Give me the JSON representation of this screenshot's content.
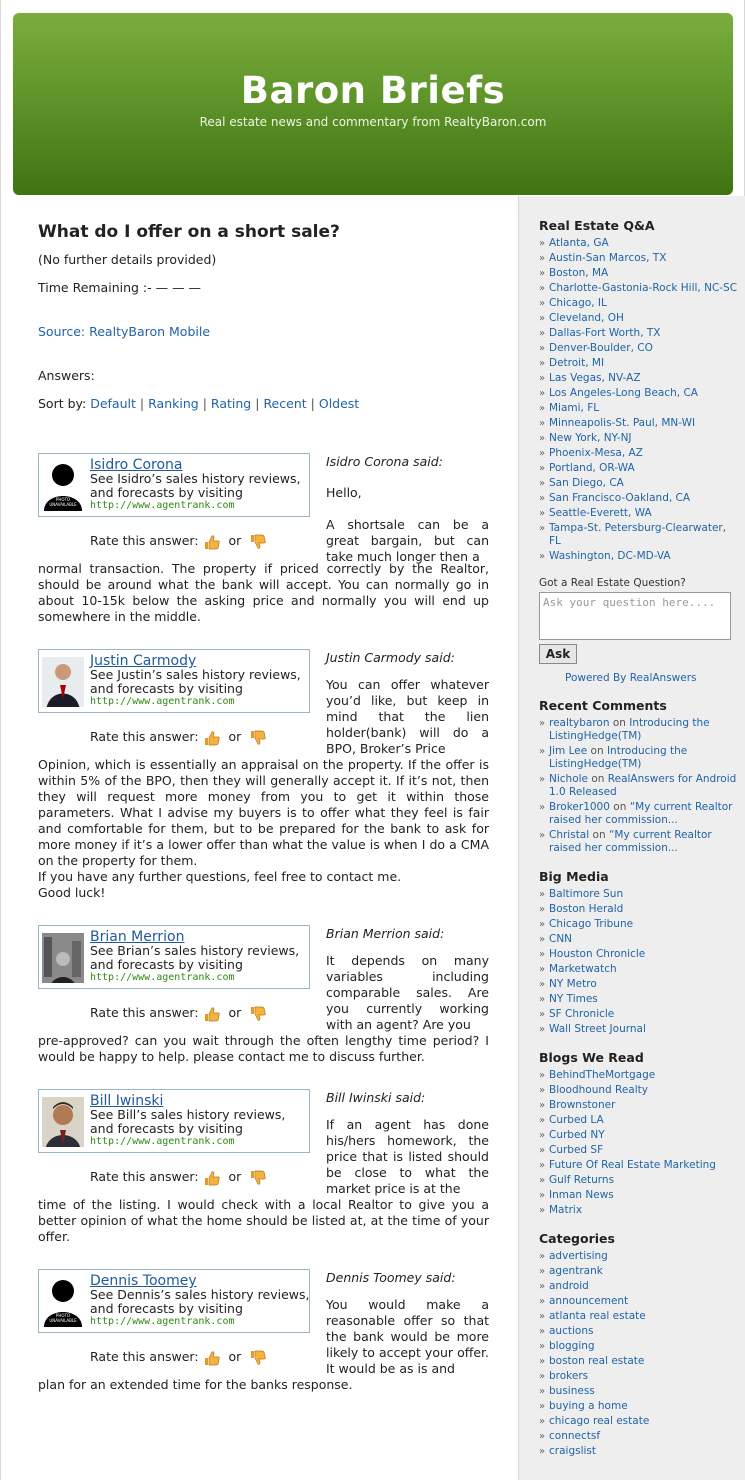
{
  "site": {
    "title": "Baron Briefs",
    "tagline": "Real estate news and commentary from RealtyBaron.com"
  },
  "post": {
    "title": "What do I offer on a short sale?",
    "details": "(No further details provided)",
    "time_remaining": "Time Remaining :- — — —",
    "source": "Source: RealtyBaron Mobile",
    "answers_label": "Answers:",
    "sort_label": "Sort by:",
    "sort_options": [
      "Default",
      "Ranking",
      "Rating",
      "Recent",
      "Oldest"
    ]
  },
  "rate_label": "Rate this answer:",
  "rate_or": "or",
  "answers": [
    {
      "name": "Isidro Corona",
      "desc": "See Isidro’s sales history reviews, and forecasts by visiting",
      "url": "http://www.agentrank.com",
      "said": "Isidro Corona said:",
      "hello": "Hello,",
      "text_side": "A shortsale can be a great bargain, but can take much longer then a",
      "text_full": "normal transaction. The property if priced correctly by the Realtor, should be around what the bank will accept. You can normally go in about 10-15k below the asking price and normally you will end up somewhere in the middle."
    },
    {
      "name": "Justin Carmody",
      "desc": "See Justin’s sales history reviews, and forecasts by visiting",
      "url": "http://www.agentrank.com",
      "said": "Justin Carmody said:",
      "text_side": "You can offer whatever you’d like, but keep in mind that the lien holder(bank) will do a BPO, Broker’s Price",
      "text_full": "Opinion, which is essentially an appraisal on the property. If the offer is within 5% of the BPO, then they will generally accept it. If it’s not, then they will request more money from you to get it within those parameters. What I advise my buyers is to offer what they feel is fair and comfortable for them, but to be prepared for the bank to ask for more money if it’s a lower offer than what the value is when I do a CMA on the property for them.",
      "text_extra1": "If you have any further questions, feel free to contact me.",
      "text_extra2": "Good luck!"
    },
    {
      "name": "Brian Merrion",
      "desc": "See Brian’s sales history reviews, and forecasts by visiting",
      "url": "http://www.agentrank.com",
      "said": "Brian Merrion said:",
      "text_side": "It depends on many variables including comparable sales. Are you currently working with an agent? Are you",
      "text_full": "pre-approved? can you wait through the often lengthy time period? I would be happy to help. please contact me to discuss further."
    },
    {
      "name": "Bill Iwinski",
      "desc": "See Bill’s sales history reviews, and forecasts by visiting",
      "url": "http://www.agentrank.com",
      "said": "Bill Iwinski said:",
      "text_side": "If an agent has done his/hers homework, the price that is listed should be close to what the market price is at the",
      "text_full": "time of the listing. I would check with a local Realtor to give you a better opinion of what the home should be listed at, at the time of your offer."
    },
    {
      "name": "Dennis Toomey",
      "desc": "See Dennis’s sales history reviews, and forecasts by visiting",
      "url": "http://www.agentrank.com",
      "said": "Dennis Toomey said:",
      "text_side": "You would make a reasonable offer so that the bank would be more likely to accept your offer. It would be as is and",
      "text_full": "plan for an extended time for the banks response."
    }
  ],
  "sidebar": {
    "qa_title": "Real Estate Q&A",
    "qa_items": [
      "Atlanta, GA",
      "Austin-San Marcos, TX",
      "Boston, MA",
      "Charlotte-Gastonia-Rock Hill, NC-SC",
      "Chicago, IL",
      "Cleveland, OH",
      "Dallas-Fort Worth, TX",
      "Denver-Boulder, CO",
      "Detroit, MI",
      "Las Vegas, NV-AZ",
      "Los Angeles-Long Beach, CA",
      "Miami, FL",
      "Minneapolis-St. Paul, MN-WI",
      "New York, NY-NJ",
      "Phoenix-Mesa, AZ",
      "Portland, OR-WA",
      "San Diego, CA",
      "San Francisco-Oakland, CA",
      "Seattle-Everett, WA",
      "Tampa-St. Petersburg-Clearwater, FL",
      "Washington, DC-MD-VA"
    ],
    "ask_label": "Got a Real Estate Question?",
    "ask_placeholder": "Ask your question here....",
    "ask_button": "Ask",
    "powered": "Powered By RealAnswers",
    "recent_title": "Recent Comments",
    "recent": [
      {
        "who": "realtybaron",
        "on": "on",
        "what": "Introducing the ListingHedge(TM)"
      },
      {
        "who": "Jim Lee",
        "on": "on",
        "what": "Introducing the ListingHedge(TM)"
      },
      {
        "who": "Nichole",
        "on": "on",
        "what": "RealAnswers for Android 1.0 Released"
      },
      {
        "who": "Broker1000",
        "on": "on",
        "what": "“My current Realtor raised her commission..."
      },
      {
        "who": "Christal",
        "on": "on",
        "what": "“My current Realtor raised her commission..."
      }
    ],
    "bigmedia_title": "Big Media",
    "bigmedia": [
      "Baltimore Sun",
      "Boston Herald",
      "Chicago Tribune",
      "CNN",
      "Houston Chronicle",
      "Marketwatch",
      "NY Metro",
      "NY Times",
      "SF Chronicle",
      "Wall Street Journal"
    ],
    "blogs_title": "Blogs We Read",
    "blogs": [
      "BehindTheMortgage",
      "Bloodhound Realty",
      "Brownstoner",
      "Curbed LA",
      "Curbed NY",
      "Curbed SF",
      "Future Of Real Estate Marketing",
      "Gulf Returns",
      "Inman News",
      "Matrix"
    ],
    "cat_title": "Categories",
    "categories": [
      "advertising",
      "agentrank",
      "android",
      "announcement",
      "atlanta real estate",
      "auctions",
      "blogging",
      "boston real estate",
      "brokers",
      "business",
      "buying a home",
      "chicago real estate",
      "connectsf",
      "craigslist"
    ]
  }
}
